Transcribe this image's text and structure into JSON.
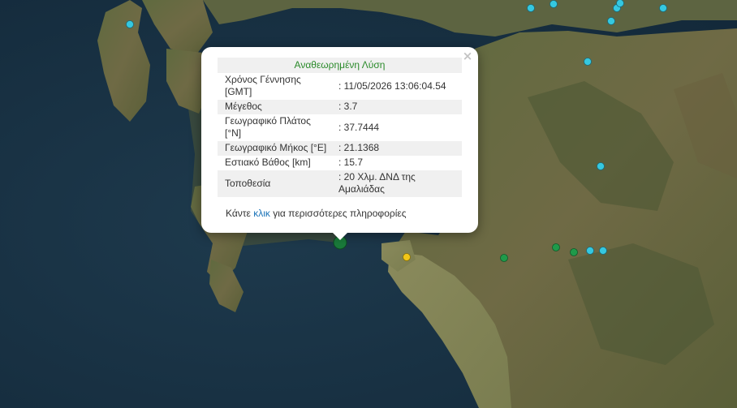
{
  "popup": {
    "status": "Αναθεωρημένη Λύση",
    "close_symbol": "×",
    "rows": [
      {
        "label": "Χρόνος Γέννησης [GMT]",
        "value": ": 11/05/2026 13:06:04.54"
      },
      {
        "label": "Μέγεθος",
        "value": ": 3.7"
      },
      {
        "label": "Γεωγραφικό Πλάτος [°N]",
        "value": ": 37.7444"
      },
      {
        "label": "Γεωγραφικό Μήκος [°E]",
        "value": ": 21.1368"
      },
      {
        "label": "Εστιακό Βάθος [km]",
        "value": ": 15.7"
      },
      {
        "label": "Τοποθεσία",
        "value": ": 20 Χλμ. ΔΝΔ της Αμαλιάδας"
      }
    ],
    "more_prefix": "Κάντε ",
    "more_link": "κλικ",
    "more_suffix": " για περισσότερες πληροφορίες"
  },
  "colors": {
    "recent_event": "#1a7a3a",
    "day_event": "#1f9a4a",
    "week_event": "#35c8e0",
    "hour_event": "#f2c618",
    "status_text": "#2a8a2a",
    "link": "#1a73b8"
  }
}
